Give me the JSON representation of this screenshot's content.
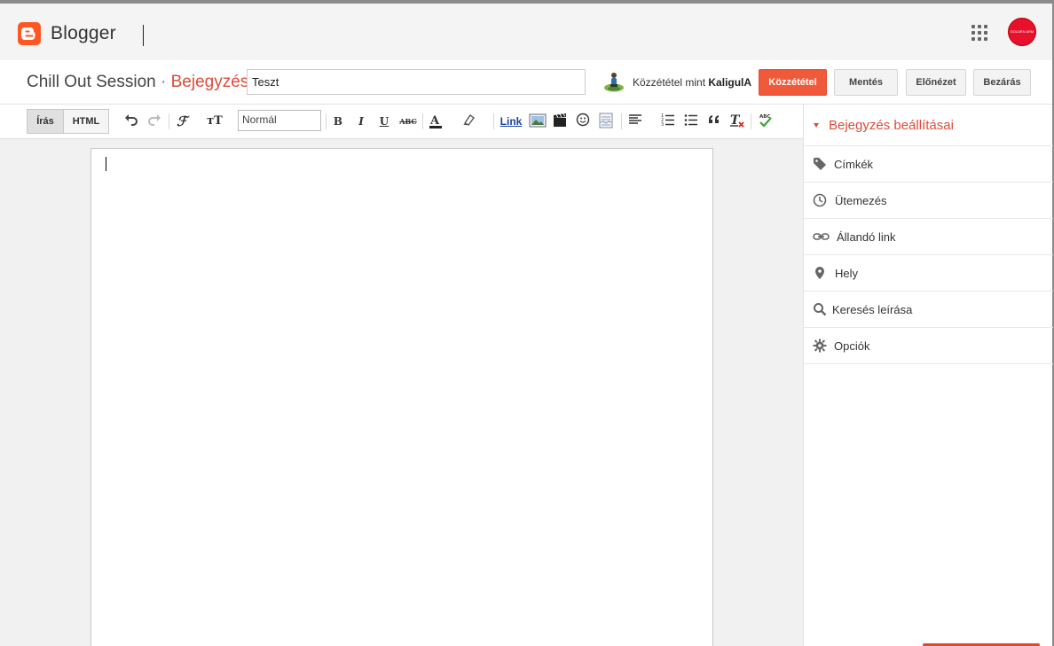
{
  "header": {
    "brand": "Blogger",
    "apps_icon": "apps-grid-icon",
    "account_avatar_text": "GOLDEN ARM"
  },
  "postbar": {
    "blog_name": "Chill Out Session",
    "separator": "·",
    "section": "Bejegyzés",
    "title_value": "Teszt",
    "publish_as_label": "Közzététel mint",
    "publish_as_user": "KaligulA",
    "buttons": {
      "publish": "Közzététel",
      "save": "Mentés",
      "preview": "Előnézet",
      "close": "Bezárás"
    }
  },
  "toolbar": {
    "mode_write": "Írás",
    "mode_html": "HTML",
    "format_value": "Normál",
    "link_label": "Link",
    "spell_label": "ABC",
    "strike_label": "ABC"
  },
  "sidebar": {
    "title": "Bejegyzés beállításai",
    "items": [
      {
        "label": "Címkék",
        "icon": "tag-icon"
      },
      {
        "label": "Ütemezés",
        "icon": "clock-icon"
      },
      {
        "label": "Állandó link",
        "icon": "link-icon"
      },
      {
        "label": "Hely",
        "icon": "location-pin-icon"
      },
      {
        "label": "Keresés leírása",
        "icon": "search-icon"
      },
      {
        "label": "Opciók",
        "icon": "gear-icon"
      }
    ]
  },
  "colors": {
    "accent": "#dd4b39",
    "publish_button": "#f05a3a",
    "logo": "#ff5722"
  }
}
